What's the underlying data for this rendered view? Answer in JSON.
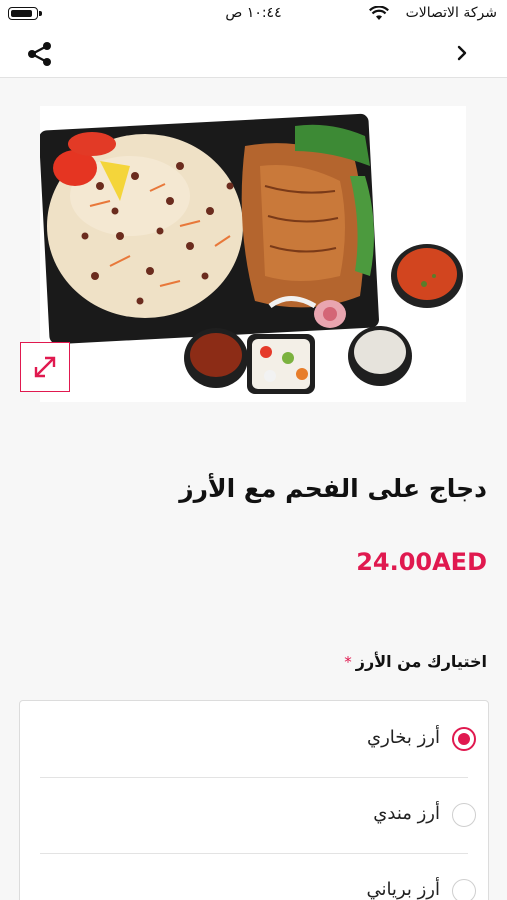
{
  "status_bar": {
    "carrier": "شركة الاتصالات",
    "time": "١٠:٤٤ ص",
    "battery_level": 0.9
  },
  "nav": {
    "back_icon": "chevron-right-icon",
    "share_icon": "share-icon"
  },
  "product": {
    "image_icon": "food-photo",
    "expand_icon": "expand-arrows-icon",
    "title": "دجاج على الفحم مع الأرز",
    "price": "24.00AED"
  },
  "options": {
    "heading": "اختيارك من الأرز",
    "required_mark": "*",
    "selected_index": 0,
    "items": [
      {
        "label": "أرز بخاري"
      },
      {
        "label": "أرز مندي"
      },
      {
        "label": "أرز برياني"
      }
    ]
  },
  "colors": {
    "accent": "#e0194f"
  }
}
